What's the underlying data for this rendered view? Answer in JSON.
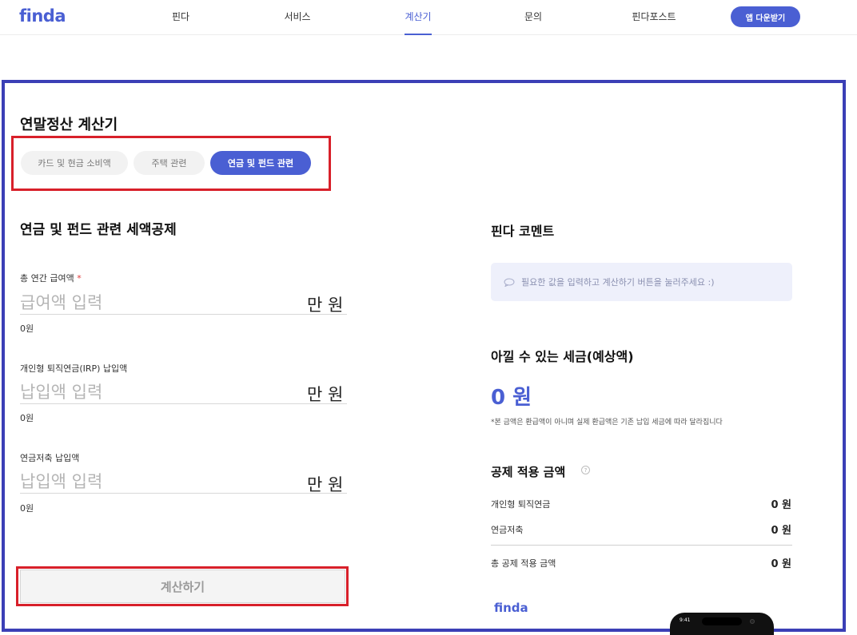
{
  "nav": {
    "logo": "finda",
    "items": [
      "핀다",
      "서비스",
      "계산기",
      "문의",
      "핀다포스트"
    ],
    "active_index": 2,
    "app_button": "앱 다운받기"
  },
  "calculator": {
    "title": "연말정산 계산기",
    "tabs": [
      "카드 및 현금 소비액",
      "주택 관련",
      "연금 및 펀드 관련"
    ],
    "active_tab": 2,
    "section_title": "연금 및 펀드 관련 세액공제",
    "fields": [
      {
        "label": "총 연간 급여액",
        "required_mark": "*",
        "placeholder": "급여액 입력",
        "value": "",
        "unit": "만 원",
        "sub": "0원"
      },
      {
        "label": "개인형 퇴직연금(IRP) 납입액",
        "placeholder": "납입액 입력",
        "value": "",
        "unit": "만 원",
        "sub": "0원"
      },
      {
        "label": "연금저축 납입액",
        "placeholder": "납입액 입력",
        "value": "",
        "unit": "만 원",
        "sub": "0원"
      }
    ],
    "submit_label": "계산하기"
  },
  "result": {
    "comment_title": "핀다 코멘트",
    "comment_text": "필요한 값을 입력하고 계산하기 버튼을 눌러주세요 :)",
    "saving_title": "아낄 수 있는 세금(예상액)",
    "saving_amount": "0 원",
    "saving_note": "*본 금액은 환급액이 아니며 실제 환급액은 기존 납입 세금에 따라 달라집니다",
    "deduction_title": "공제 적용 금액",
    "help_glyph": "?",
    "rows": [
      {
        "label": "개인형 퇴직연금",
        "value": "0 원"
      },
      {
        "label": "연금저축",
        "value": "0 원"
      }
    ],
    "total": {
      "label": "총 공제 적용 금액",
      "value": "0 원"
    }
  },
  "footer": {
    "logo": "finda",
    "phone_time": "9:41"
  },
  "colors": {
    "brand": "#4a5fd3",
    "highlight_red": "#d8202a",
    "highlight_blue": "#3b3fb6"
  }
}
